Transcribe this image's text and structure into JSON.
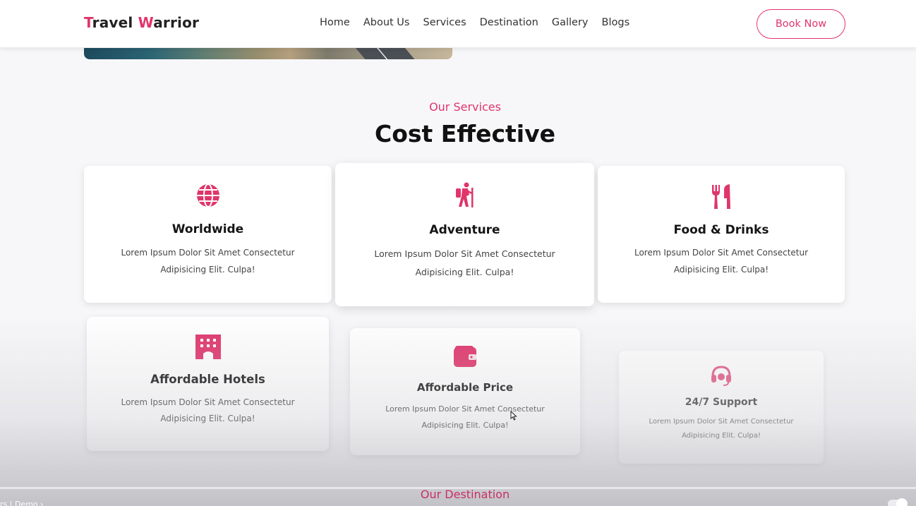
{
  "nav": {
    "logo_first_letter": "T",
    "logo_first_rest": "ravel ",
    "logo_second_letter": "W",
    "logo_second_rest": "arrior",
    "links": [
      "Home",
      "About Us",
      "Services",
      "Destination",
      "Gallery",
      "Blogs"
    ],
    "book_label": "Book Now"
  },
  "section": {
    "subtitle": "Our Services",
    "heading": "Cost Effective"
  },
  "services": [
    {
      "title": "Worldwide",
      "line1": "Lorem Ipsum Dolor Sit Amet Consectetur",
      "line2": "Adipisicing Elit. Culpa!",
      "icon": "globe-icon"
    },
    {
      "title": "Adventure",
      "line1": "Lorem Ipsum Dolor Sit Amet Consectetur",
      "line2": "Adipisicing Elit. Culpa!",
      "icon": "hiking-icon"
    },
    {
      "title": "Food & Drinks",
      "line1": "Lorem Ipsum Dolor Sit Amet Consectetur",
      "line2": "Adipisicing Elit. Culpa!",
      "icon": "utensils-icon"
    },
    {
      "title": "Affordable Hotels",
      "line1": "Lorem Ipsum Dolor Sit Amet Consectetur",
      "line2": "Adipisicing Elit. Culpa!",
      "icon": "hotel-icon"
    },
    {
      "title": "Affordable Price",
      "line1": "Lorem Ipsum Dolor Sit Amet Consectetur",
      "line2": "Adipisicing Elit. Culpa!",
      "icon": "wallet-icon"
    },
    {
      "title": "24/7 Support",
      "line1": "Lorem Ipsum Dolor Sit Amet Consectetur",
      "line2": "Adipisicing Elit. Culpa!",
      "icon": "headset-icon"
    }
  ],
  "next_section": {
    "subtitle": "Our Destination"
  },
  "video_overlay": {
    "crumb": "rs  |  Demo  ›"
  },
  "colors": {
    "accent": "#e0356b",
    "text": "#111111",
    "background": "#f7f7f9"
  }
}
